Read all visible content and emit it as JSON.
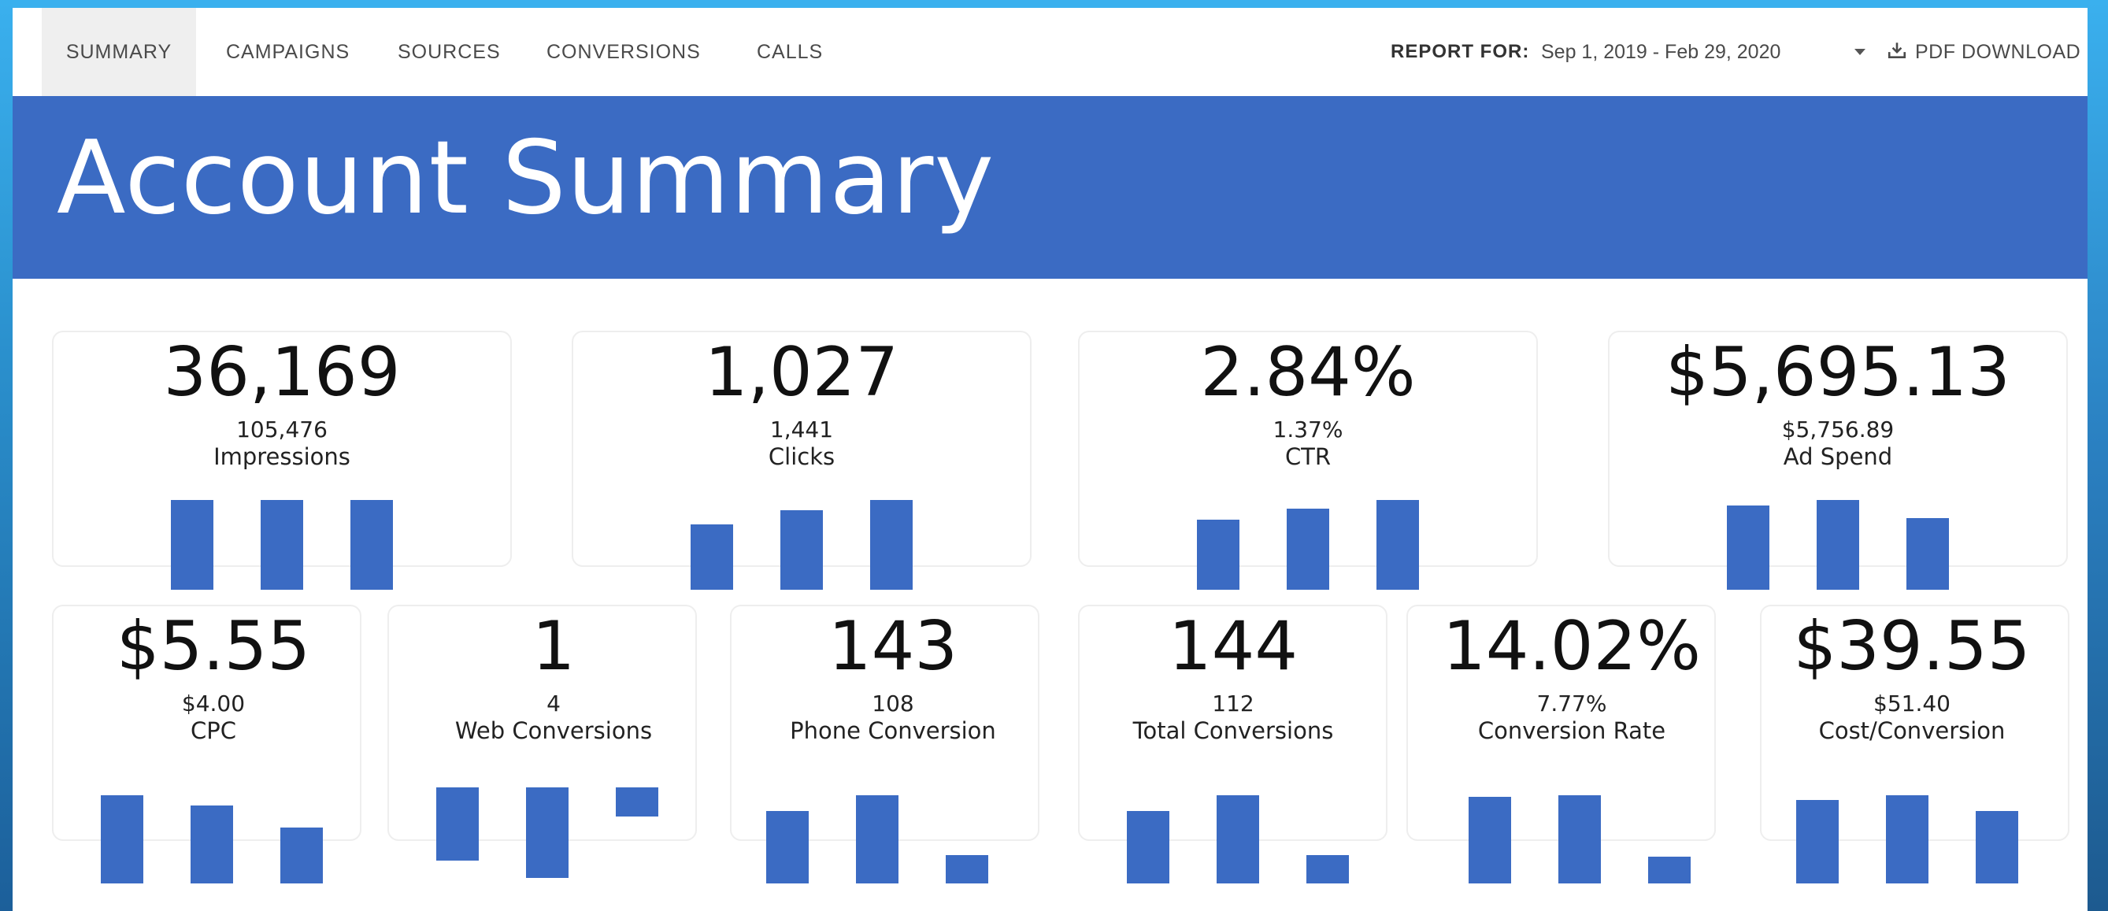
{
  "nav": {
    "tabs": [
      {
        "label": "SUMMARY",
        "active": true
      },
      {
        "label": "CAMPAIGNS",
        "active": false
      },
      {
        "label": "SOURCES",
        "active": false
      },
      {
        "label": "CONVERSIONS",
        "active": false
      },
      {
        "label": "CALLS",
        "active": false
      }
    ],
    "report_label": "REPORT FOR:",
    "date_range": "Sep 1, 2019 - Feb 29, 2020",
    "pdf_label": "PDF DOWNLOAD"
  },
  "banner": {
    "title": "Account Summary"
  },
  "colors": {
    "accent": "#3b6bc3",
    "background": "#3ab0ee"
  },
  "metrics": [
    {
      "value": "36,169",
      "previous": "105,476",
      "label": "Impressions",
      "trend_bars": [
        {
          "top": 0.0,
          "bottom": 1.0
        },
        {
          "top": 0.0,
          "bottom": 1.0
        },
        {
          "top": 0.0,
          "bottom": 1.0
        }
      ]
    },
    {
      "value": "1,027",
      "previous": "1,441",
      "label": "Clicks",
      "trend_bars": [
        {
          "top": 0.27,
          "bottom": 1.0
        },
        {
          "top": 0.11,
          "bottom": 1.0
        },
        {
          "top": 0.0,
          "bottom": 1.0
        }
      ]
    },
    {
      "value": "2.84%",
      "previous": "1.37%",
      "label": "CTR",
      "trend_bars": [
        {
          "top": 0.22,
          "bottom": 1.0
        },
        {
          "top": 0.1,
          "bottom": 1.0
        },
        {
          "top": 0.0,
          "bottom": 1.0
        }
      ]
    },
    {
      "value": "$5,695.13",
      "previous": "$5,756.89",
      "label": "Ad Spend",
      "trend_bars": [
        {
          "top": 0.06,
          "bottom": 1.0
        },
        {
          "top": 0.0,
          "bottom": 1.0
        },
        {
          "top": 0.2,
          "bottom": 1.0
        }
      ]
    },
    {
      "value": "$5.55",
      "previous": "$4.00",
      "label": "CPC",
      "trend_bars": [
        {
          "top": 0.0,
          "bottom": 1.0
        },
        {
          "top": 0.12,
          "bottom": 1.0
        },
        {
          "top": 0.37,
          "bottom": 1.0
        }
      ]
    },
    {
      "value": "1",
      "previous": "4",
      "label": "Web Conversions",
      "trend_bars": [
        {
          "top": 0.0,
          "bottom": 0.81
        },
        {
          "top": 0.0,
          "bottom": 1.0
        },
        {
          "top": 0.0,
          "bottom": 0.32
        }
      ]
    },
    {
      "value": "143",
      "previous": "108",
      "label": "Phone Conversion",
      "trend_bars": [
        {
          "top": 0.18,
          "bottom": 1.0
        },
        {
          "top": 0.0,
          "bottom": 1.0
        },
        {
          "top": 0.68,
          "bottom": 1.0
        }
      ]
    },
    {
      "value": "144",
      "previous": "112",
      "label": "Total Conversions",
      "trend_bars": [
        {
          "top": 0.18,
          "bottom": 1.0
        },
        {
          "top": 0.0,
          "bottom": 1.0
        },
        {
          "top": 0.68,
          "bottom": 1.0
        }
      ]
    },
    {
      "value": "14.02%",
      "previous": "7.77%",
      "label": "Conversion Rate",
      "trend_bars": [
        {
          "top": 0.02,
          "bottom": 1.0
        },
        {
          "top": 0.0,
          "bottom": 1.0
        },
        {
          "top": 0.7,
          "bottom": 1.0
        }
      ]
    },
    {
      "value": "$39.55",
      "previous": "$51.40",
      "label": "Cost/Conversion",
      "trend_bars": [
        {
          "top": 0.05,
          "bottom": 1.0
        },
        {
          "top": 0.0,
          "bottom": 1.0
        },
        {
          "top": 0.18,
          "bottom": 1.0
        }
      ]
    }
  ]
}
